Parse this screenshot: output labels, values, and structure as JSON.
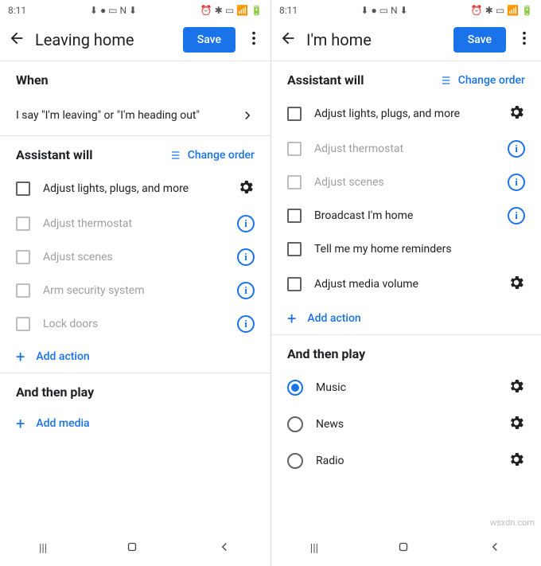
{
  "statusbar": {
    "time": "8:11"
  },
  "left": {
    "title": "Leaving home",
    "save": "Save",
    "when_header": "When",
    "trigger_text": "I say \"I'm leaving\" or \"I'm heading out\"",
    "assistant_header": "Assistant will",
    "change_order": "Change order",
    "items": [
      {
        "label": "Adjust lights, plugs, and more",
        "enabled": true,
        "trailing": "gear"
      },
      {
        "label": "Adjust thermostat",
        "enabled": false,
        "trailing": "info"
      },
      {
        "label": "Adjust scenes",
        "enabled": false,
        "trailing": "info"
      },
      {
        "label": "Arm security system",
        "enabled": false,
        "trailing": "info"
      },
      {
        "label": "Lock doors",
        "enabled": false,
        "trailing": "info"
      }
    ],
    "add_action": "Add action",
    "play_header": "And then play",
    "add_media": "Add media"
  },
  "right": {
    "title": "I'm home",
    "save": "Save",
    "assistant_header": "Assistant will",
    "change_order": "Change order",
    "items": [
      {
        "label": "Adjust lights, plugs, and more",
        "enabled": true,
        "trailing": "gear"
      },
      {
        "label": "Adjust thermostat",
        "enabled": false,
        "trailing": "info"
      },
      {
        "label": "Adjust scenes",
        "enabled": false,
        "trailing": "info"
      },
      {
        "label": "Broadcast I'm home",
        "enabled": true,
        "trailing": "info"
      },
      {
        "label": "Tell me my home reminders",
        "enabled": true,
        "trailing": "none"
      },
      {
        "label": "Adjust media volume",
        "enabled": true,
        "trailing": "gear"
      }
    ],
    "add_action": "Add action",
    "play_header": "And then play",
    "play_items": [
      {
        "label": "Music",
        "selected": true
      },
      {
        "label": "News",
        "selected": false
      },
      {
        "label": "Radio",
        "selected": false
      }
    ]
  },
  "watermark": "wsxdn.com"
}
